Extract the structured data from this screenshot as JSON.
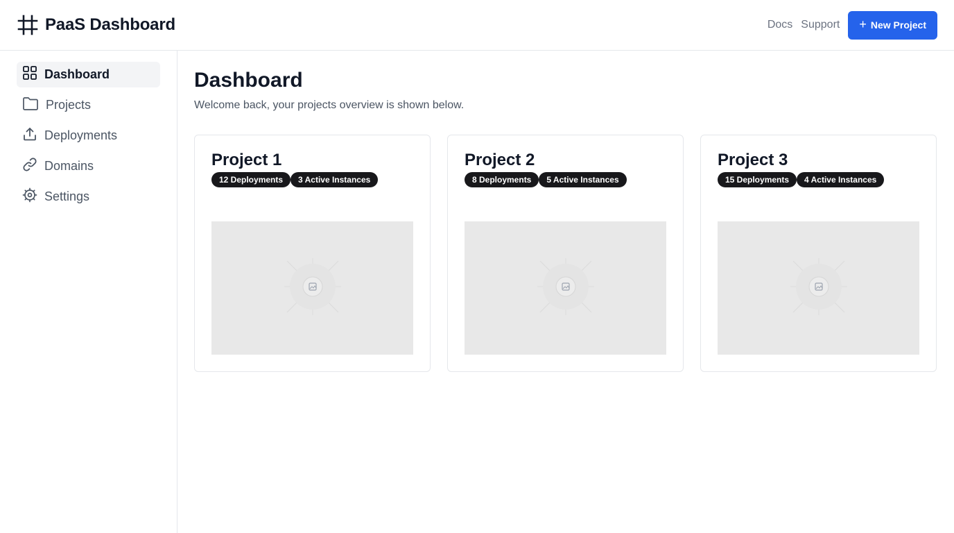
{
  "header": {
    "brand_title": "PaaS Dashboard",
    "brand_icon": "hash-icon",
    "links": [
      "Docs",
      "Support"
    ],
    "new_project_label": "New Project"
  },
  "sidebar": {
    "items": [
      {
        "label": "Dashboard",
        "icon": "grid-icon",
        "active": true
      },
      {
        "label": "Projects",
        "icon": "folder-icon",
        "active": false
      },
      {
        "label": "Deployments",
        "icon": "upload-icon",
        "active": false
      },
      {
        "label": "Domains",
        "icon": "link-icon",
        "active": false
      },
      {
        "label": "Settings",
        "icon": "gear-icon",
        "active": false
      }
    ]
  },
  "main": {
    "title": "Dashboard",
    "subtitle": "Welcome back, your projects overview is shown below.",
    "projects": [
      {
        "name": "Project 1",
        "deployments": "12 Deployments",
        "instances": "3 Active Instances"
      },
      {
        "name": "Project 2",
        "deployments": "8 Deployments",
        "instances": "5 Active Instances"
      },
      {
        "name": "Project 3",
        "deployments": "15 Deployments",
        "instances": "4 Active Instances"
      }
    ]
  },
  "colors": {
    "accent": "#2563eb",
    "badge_bg": "#18181b",
    "active_nav_bg": "#f3f4f6",
    "placeholder_bg": "#e8e8e8"
  }
}
